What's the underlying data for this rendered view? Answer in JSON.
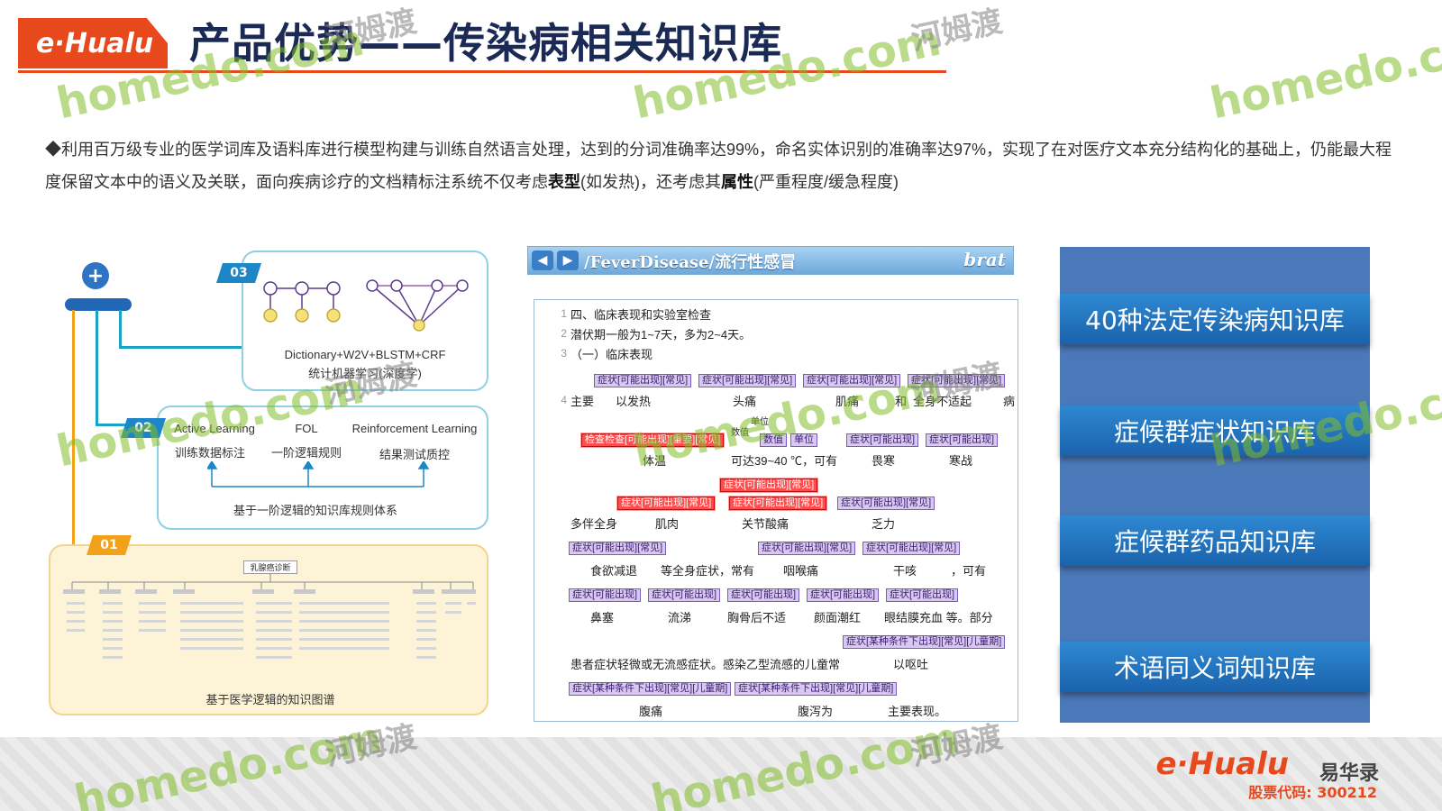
{
  "header": {
    "logo": "e·Hualu",
    "title": "产品优势——传染病相关知识库"
  },
  "description": {
    "part1": "◆利用百万级专业的医学词库及语料库进行模型构建与训练自然语言处理，达到的分词准确率达99%，命名实体识别的准确率达97%，实现了在对医疗文本充分结构化的基础上，仍能最大程度保留文本中的语义及关联，面向疾病诊疗的文档精标注系统不仅考虑",
    "bold1": "表型",
    "part2": "(如发热)，还考虑其",
    "bold2": "属性",
    "part3": "(严重程度/缓急程度)"
  },
  "diagram": {
    "tag03": "03",
    "box03_line1": "Dictionary+W2V+BLSTM+CRF",
    "box03_line2": "统计机器学习(深度学)",
    "tag02": "02",
    "col1_title": "Active Learning",
    "col1_sub": "训练数据标注",
    "col2_title": "FOL",
    "col2_sub": "一阶逻辑规则",
    "col3_title": "Reinforcement Learning",
    "col3_sub": "结果测试质控",
    "box02_caption": "基于一阶逻辑的知识库规则体系",
    "tag01": "01",
    "tree_root": "乳腺癌诊断",
    "box01_caption": "基于医学逻辑的知识图谱"
  },
  "brat": {
    "path": "/FeverDisease/流行性感冒",
    "logo": "brat",
    "lines": [
      {
        "n": "1",
        "text": "四、临床表现和实验室检查"
      },
      {
        "n": "2",
        "text": "潜伏期一般为1~7天，多为2~4天。"
      },
      {
        "n": "3",
        "text": "（一）临床表现"
      },
      {
        "n": "4",
        "text": "主要"
      }
    ],
    "anns": {
      "possible_common": "症状[可能出现][常见]",
      "possible": "症状[可能出现]",
      "exam": "检查检查[可能出现][重要][常见]",
      "value": "数值",
      "unit": "单位",
      "cond_child": "症状[某种条件下出现][常见][儿童期]"
    },
    "words": {
      "w_faru": "以发热",
      "w_toutong": "头痛",
      "w_jitong": "肌痛",
      "w_he": "和",
      "w_quanshen": "全身不适起",
      "w_bing": "病",
      "w_tiwen": "体温",
      "w_keda": "可达39~40 ℃，可有",
      "w_weihan": "畏寒",
      "w_hanzhan": "寒战",
      "w_duoban": "多伴全身",
      "w_jirou": "肌肉",
      "w_guanjie": "关节酸痛",
      "w_fali": "乏力",
      "w_shiyu": "食欲减退",
      "w_dengquan": "等全身症状，常有",
      "w_yanhou": "咽喉痛",
      "w_ganke": "干咳",
      "w_keyou": "，可有",
      "w_bisai": "鼻塞",
      "w_liuti": "流涕",
      "w_xionggu": "胸骨后不适",
      "w_yanmian": "颜面潮红",
      "w_yanjie": "眼结膜充血 等。部分",
      "w_huanzhe": "患者症状轻微或无流感症状。感染乙型流感的儿童常",
      "w_outu": "以呕吐",
      "w_futong": "腹痛",
      "w_fuxie": "腹泻为",
      "w_zhuyao": "主要表现。"
    }
  },
  "knowledge_bases": [
    "40种法定传染病知识库",
    "症候群症状知识库",
    "症候群药品知识库",
    "术语同义词知识库"
  ],
  "footer": {
    "logo": "e·Hualu",
    "cn": "易华录",
    "code": "股票代码: 300212"
  },
  "watermark": {
    "domain": "homedo.com",
    "cn": "河姆渡"
  },
  "colors": {
    "brand_orange": "#e8491c",
    "title_navy": "#1b2a55",
    "kb_blue": "#2f88d2"
  }
}
